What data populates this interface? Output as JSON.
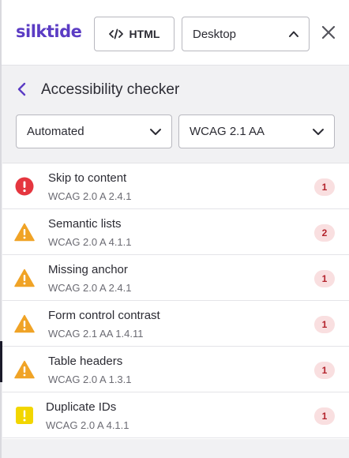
{
  "header": {
    "logo": "silktide",
    "html_button": "HTML",
    "device_select": "Desktop"
  },
  "subbar": {
    "title": "Accessibility checker",
    "filter_mode": "Automated",
    "filter_level": "WCAG 2.1 AA"
  },
  "issues": [
    {
      "title": "Skip to content",
      "ref": "WCAG 2.0 A 2.4.1",
      "count": "1",
      "severity": "error"
    },
    {
      "title": "Semantic lists",
      "ref": "WCAG 2.0 A 4.1.1",
      "count": "2",
      "severity": "warning"
    },
    {
      "title": "Missing anchor",
      "ref": "WCAG 2.0 A 2.4.1",
      "count": "1",
      "severity": "warning"
    },
    {
      "title": "Form control contrast",
      "ref": "WCAG 2.1 AA 1.4.11",
      "count": "1",
      "severity": "warning"
    },
    {
      "title": "Table headers",
      "ref": "WCAG 2.0 A 1.3.1",
      "count": "1",
      "severity": "warning"
    },
    {
      "title": "Duplicate IDs",
      "ref": "WCAG 2.0 A 4.1.1",
      "count": "1",
      "severity": "notice"
    }
  ],
  "colors": {
    "brand": "#5b3cc4",
    "error": "#e5363f",
    "warning": "#f0a326",
    "notice": "#f2d600",
    "badge_bg": "#f9dfe0",
    "badge_text": "#b3232c"
  }
}
